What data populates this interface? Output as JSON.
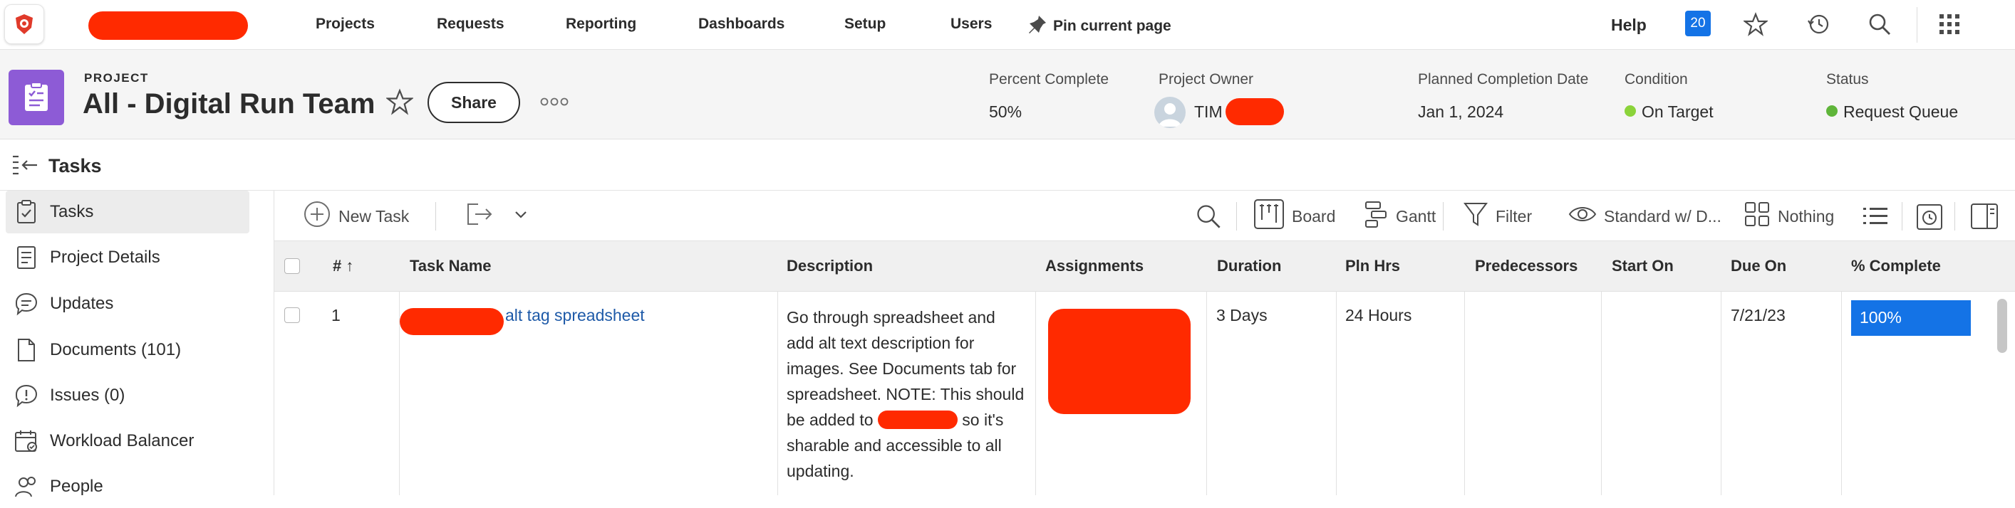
{
  "nav": {
    "items": [
      "Projects",
      "Requests",
      "Reporting",
      "Dashboards",
      "Setup",
      "Users"
    ],
    "pin_label": "Pin current page",
    "help_label": "Help",
    "notification_count": "20"
  },
  "project": {
    "type_label": "PROJECT",
    "title": "All - Digital Run Team",
    "share_label": "Share",
    "fields": {
      "percent_complete": {
        "label": "Percent Complete",
        "value": "50%"
      },
      "owner": {
        "label": "Project Owner",
        "value": "TIM"
      },
      "planned_completion": {
        "label": "Planned Completion Date",
        "value": "Jan 1, 2024"
      },
      "condition": {
        "label": "Condition",
        "value": "On Target",
        "color": "#2d9d3a"
      },
      "status": {
        "label": "Status",
        "value": "Request Queue",
        "color": "#2d9d3a"
      }
    }
  },
  "section_title": "Tasks",
  "sidebar": {
    "items": [
      {
        "label": "Tasks",
        "icon": "clipboard-check-icon",
        "active": true
      },
      {
        "label": "Project Details",
        "icon": "document-icon"
      },
      {
        "label": "Updates",
        "icon": "chat-bubble-icon"
      },
      {
        "label": "Documents (101)",
        "icon": "file-icon"
      },
      {
        "label": "Issues (0)",
        "icon": "issue-bubble-icon"
      },
      {
        "label": "Workload Balancer",
        "icon": "calendar-icon"
      },
      {
        "label": "People",
        "icon": "people-icon"
      }
    ]
  },
  "toolbar": {
    "new_task": "New Task",
    "board": "Board",
    "gantt": "Gantt",
    "filter": "Filter",
    "view": "Standard w/ D...",
    "grouping": "Nothing"
  },
  "grid": {
    "columns": [
      "#",
      "Task Name",
      "Description",
      "Assignments",
      "Duration",
      "Pln Hrs",
      "Predecessors",
      "Start On",
      "Due On",
      "% Complete"
    ],
    "rows": [
      {
        "num": "1",
        "task_name": "alt tag spreadsheet",
        "description_lines": [
          "Go through spreadsheet and",
          "add alt text description for",
          "images. See Documents tab for",
          "spreadsheet. NOTE: This should",
          "be added to",
          "so it's",
          "sharable and accessible to all",
          "updating."
        ],
        "duration": "3 Days",
        "pln_hrs": "24 Hours",
        "predecessors": "",
        "start_on": "",
        "due_on": "7/21/23",
        "percent_complete": "100%"
      }
    ]
  }
}
